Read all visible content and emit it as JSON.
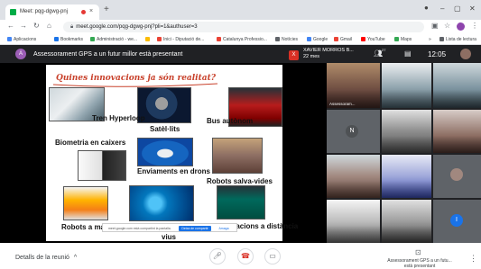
{
  "browser": {
    "tab_title": "Meet: pqg-dgwg-pnj",
    "tab_close": "×",
    "new_tab": "+",
    "url": "meet.google.com/pqg-dgwg-pnj?pli=1&authuser=3",
    "window_min": "–",
    "window_max": "▢",
    "window_close": "✕",
    "bookmarks": [
      {
        "label": "Aplicacions",
        "color": "#4285f4"
      },
      {
        "label": "Bookmarks",
        "color": "#1a73e8"
      },
      {
        "label": "Administració - we...",
        "color": "#34a853"
      },
      {
        "label": "",
        "color": "#fbbc04"
      },
      {
        "label": "Inici - Diputació de...",
        "color": "#ea4335"
      },
      {
        "label": "Catalunya Professio...",
        "color": "#ea4335"
      },
      {
        "label": "Notícies",
        "color": "#5f6368"
      },
      {
        "label": "Google",
        "color": "#4285f4"
      },
      {
        "label": "Gmail",
        "color": "#ea4335"
      },
      {
        "label": "YouTube",
        "color": "#ff0000"
      },
      {
        "label": "Maps",
        "color": "#34a853"
      },
      {
        "label": "»",
        "color": ""
      },
      {
        "label": "Lista de lectura",
        "color": "#5f6368"
      }
    ]
  },
  "meet": {
    "presenter_initial": "A",
    "presentation_title": "Assessorament GPS a un futur millor està presentant",
    "speaker_initial": "X",
    "speaker_name": "XAVIER MORROS B...",
    "speaker_duration": "22 mes",
    "participant_count": "27",
    "time": "12:05",
    "tiles": [
      {
        "label": "Assessoram..."
      },
      {
        "label": ""
      },
      {
        "label": ""
      },
      {
        "label": ""
      },
      {
        "label": ""
      },
      {
        "label": ""
      },
      {
        "label": ""
      },
      {
        "label": ""
      },
      {
        "label": ""
      },
      {
        "label": ""
      },
      {
        "label": ""
      },
      {
        "label": ""
      }
    ],
    "avatar_n": "N",
    "avatar_i": "I",
    "details_label": "Detalls de la reunió",
    "details_chevron": "^",
    "presenting_label": "Assessorament GPS a un futu... està presentant",
    "more": "⋮"
  },
  "slide": {
    "title": "Quines innovacions ja són realitat?",
    "items": [
      {
        "label": "Tren Hyperloop"
      },
      {
        "label": "Satèl·lits"
      },
      {
        "label": "Bus autònom"
      },
      {
        "label": "Biometria en caixers"
      },
      {
        "label": "Enviaments en drons"
      },
      {
        "label": "Robots salva-vides"
      },
      {
        "label": "Robots a magatzems"
      },
      {
        "label": "vius"
      },
      {
        "label": "operacions a distància"
      }
    ],
    "sharing_text": "meet.google.com està compartint la pantalla.",
    "stop_sharing": "Deixa de compartir",
    "hide": "Amaga"
  },
  "colors": {
    "meet_bg": "#202124",
    "slide_title": "#c8402a",
    "hangup": "#d93025",
    "accent": "#1a73e8"
  }
}
